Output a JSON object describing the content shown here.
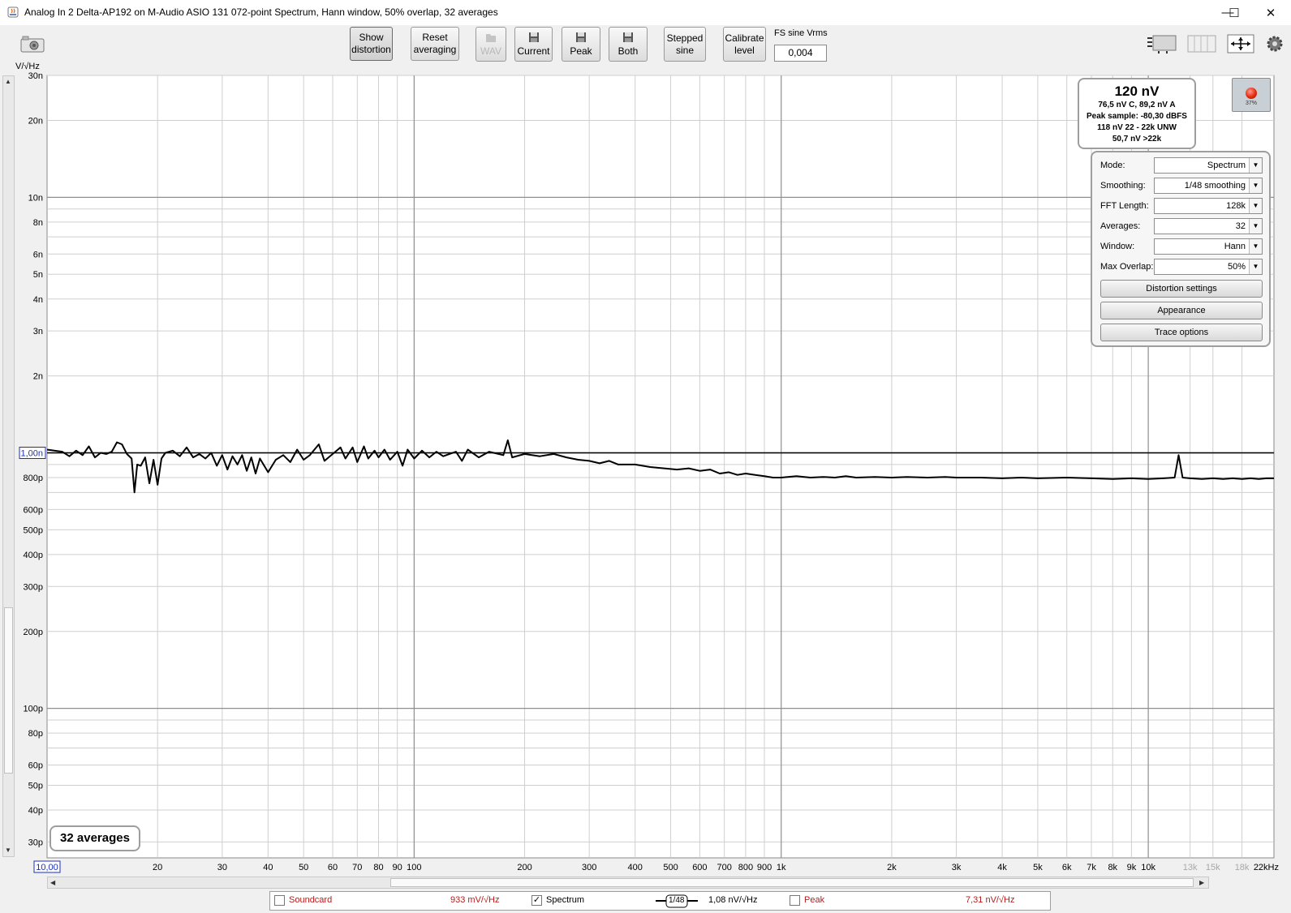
{
  "window": {
    "title": "Analog In 2 Delta-AP192 on M-Audio ASIO 131 072-point Spectrum, Hann window, 50% overlap, 32 averages",
    "controls": {
      "minimize": "—",
      "maximize": "☐",
      "close": "✕"
    }
  },
  "toolbar": {
    "show_distortion": "Show\ndistortion",
    "reset_averaging": "Reset\naveraging",
    "wav": "WAV",
    "current": "Current",
    "peak": "Peak",
    "both": "Both",
    "stepped_sine": "Stepped\nsine",
    "calibrate_level": "Calibrate\nlevel",
    "fs_sine_label": "FS sine Vrms",
    "fs_sine_value": "0,004"
  },
  "readout": {
    "main": "120 nV",
    "line1": "76,5 nV C, 89,2 nV A",
    "line2": "Peak sample: -80,30 dBFS",
    "line3": "118 nV 22 - 22k UNW",
    "line4": "50,7 nV >22k"
  },
  "record": {
    "percent": "37%"
  },
  "settings": {
    "mode_label": "Mode:",
    "mode_value": "Spectrum",
    "smoothing_label": "Smoothing:",
    "smoothing_value": "1/48 smoothing",
    "fft_label": "FFT Length:",
    "fft_value": "128k",
    "averages_label": "Averages:",
    "averages_value": "32",
    "window_label": "Window:",
    "window_value": "Hann",
    "overlap_label": "Max Overlap:",
    "overlap_value": "50%",
    "distortion_settings": "Distortion settings",
    "appearance": "Appearance",
    "trace_options": "Trace options"
  },
  "avg_badge": "32 averages",
  "legend": {
    "soundcard_label": "Soundcard",
    "soundcard_value": "933 mV/√Hz",
    "soundcard_checked": false,
    "spectrum_label": "Spectrum",
    "spectrum_value": "1,08 nV/√Hz",
    "spectrum_checked": true,
    "smoothing_tag": "1/48",
    "peak_label": "Peak",
    "peak_value": "7,31 nV/√Hz",
    "peak_checked": false,
    "check_mark": "✓"
  },
  "chart_data": {
    "type": "line",
    "ylabel": "V/√Hz",
    "xlabel": "",
    "x_scale": "log",
    "y_scale": "log",
    "xlim": [
      10,
      22000
    ],
    "ylim": [
      2.6e-11,
      3e-08
    ],
    "grid": true,
    "y_ticks": [
      {
        "v": 3e-08,
        "label": "30n",
        "major": false
      },
      {
        "v": 2e-08,
        "label": "20n",
        "major": false
      },
      {
        "v": 1e-08,
        "label": "10n",
        "major": true
      },
      {
        "v": 8e-09,
        "label": "8n",
        "major": false
      },
      {
        "v": 6e-09,
        "label": "6n",
        "major": false
      },
      {
        "v": 5e-09,
        "label": "5n",
        "major": false
      },
      {
        "v": 4e-09,
        "label": "4n",
        "major": false
      },
      {
        "v": 3e-09,
        "label": "3n",
        "major": false
      },
      {
        "v": 2e-09,
        "label": "2n",
        "major": false
      },
      {
        "v": 1e-09,
        "label": "1,00n",
        "major": true,
        "boxed": true
      },
      {
        "v": 8e-10,
        "label": "800p",
        "major": false
      },
      {
        "v": 6e-10,
        "label": "600p",
        "major": false
      },
      {
        "v": 5e-10,
        "label": "500p",
        "major": false
      },
      {
        "v": 4e-10,
        "label": "400p",
        "major": false
      },
      {
        "v": 3e-10,
        "label": "300p",
        "major": false
      },
      {
        "v": 2e-10,
        "label": "200p",
        "major": false
      },
      {
        "v": 1e-10,
        "label": "100p",
        "major": true
      },
      {
        "v": 8e-11,
        "label": "80p",
        "major": false
      },
      {
        "v": 6e-11,
        "label": "60p",
        "major": false
      },
      {
        "v": 5e-11,
        "label": "50p",
        "major": false
      },
      {
        "v": 4e-11,
        "label": "40p",
        "major": false
      },
      {
        "v": 3e-11,
        "label": "30p",
        "major": false
      }
    ],
    "y_minor_grid": [
      3e-08,
      2e-08,
      9e-09,
      8e-09,
      7e-09,
      6e-09,
      5e-09,
      4e-09,
      3e-09,
      2e-09,
      9e-10,
      8e-10,
      7e-10,
      6e-10,
      5e-10,
      4e-10,
      3e-10,
      2e-10,
      9e-11,
      8e-11,
      7e-11,
      6e-11,
      5e-11,
      4e-11,
      3e-11
    ],
    "x_ticks": [
      {
        "v": 10,
        "label": "10,00",
        "boxed": true
      },
      {
        "v": 20,
        "label": "20"
      },
      {
        "v": 30,
        "label": "30"
      },
      {
        "v": 40,
        "label": "40"
      },
      {
        "v": 50,
        "label": "50"
      },
      {
        "v": 60,
        "label": "60"
      },
      {
        "v": 70,
        "label": "70"
      },
      {
        "v": 80,
        "label": "80"
      },
      {
        "v": 90,
        "label": "90"
      },
      {
        "v": 100,
        "label": "100"
      },
      {
        "v": 200,
        "label": "200"
      },
      {
        "v": 300,
        "label": "300"
      },
      {
        "v": 400,
        "label": "400"
      },
      {
        "v": 500,
        "label": "500"
      },
      {
        "v": 600,
        "label": "600"
      },
      {
        "v": 700,
        "label": "700"
      },
      {
        "v": 800,
        "label": "800"
      },
      {
        "v": 900,
        "label": "900"
      },
      {
        "v": 1000,
        "label": "1k"
      },
      {
        "v": 2000,
        "label": "2k"
      },
      {
        "v": 3000,
        "label": "3k"
      },
      {
        "v": 4000,
        "label": "4k"
      },
      {
        "v": 5000,
        "label": "5k"
      },
      {
        "v": 6000,
        "label": "6k"
      },
      {
        "v": 7000,
        "label": "7k"
      },
      {
        "v": 8000,
        "label": "8k"
      },
      {
        "v": 9000,
        "label": "9k"
      },
      {
        "v": 10000,
        "label": "10k"
      },
      {
        "v": 13000,
        "label": "13k",
        "faded": true
      },
      {
        "v": 15000,
        "label": "15k",
        "faded": true
      },
      {
        "v": 18000,
        "label": "18k",
        "faded": true
      },
      {
        "v": 22000,
        "label": "22kHz"
      }
    ],
    "x_major_grid": [
      100,
      1000,
      10000
    ],
    "x_minor_grid": [
      20,
      30,
      40,
      50,
      60,
      70,
      80,
      90,
      200,
      300,
      400,
      500,
      600,
      700,
      800,
      900,
      2000,
      3000,
      4000,
      5000,
      6000,
      7000,
      8000,
      9000,
      13000,
      15000,
      18000
    ],
    "reference_line_y": 1e-09,
    "series": [
      {
        "name": "Spectrum",
        "color": "#000000",
        "points": [
          [
            10,
            1.03e-09
          ],
          [
            11,
            1.01e-09
          ],
          [
            11.5,
            9.7e-10
          ],
          [
            12,
            1.02e-09
          ],
          [
            12.5,
            9.8e-10
          ],
          [
            13,
            1.06e-09
          ],
          [
            13.5,
            9.6e-10
          ],
          [
            14,
            1e-09
          ],
          [
            14.5,
            9.9e-10
          ],
          [
            15,
            1.01e-09
          ],
          [
            15.5,
            1.1e-09
          ],
          [
            16,
            1.08e-09
          ],
          [
            16.5,
            9.9e-10
          ],
          [
            17,
            9.5e-10
          ],
          [
            17.3,
            7e-10
          ],
          [
            17.6,
            9e-10
          ],
          [
            18,
            8.9e-10
          ],
          [
            18.5,
            9.6e-10
          ],
          [
            19,
            7.6e-10
          ],
          [
            19.5,
            9.4e-10
          ],
          [
            20,
            7.5e-10
          ],
          [
            20.5,
            9.5e-10
          ],
          [
            21,
            1e-09
          ],
          [
            22,
            1.02e-09
          ],
          [
            23,
            9.7e-10
          ],
          [
            24,
            1.05e-09
          ],
          [
            25,
            9.6e-10
          ],
          [
            26,
            9.9e-10
          ],
          [
            27,
            9.5e-10
          ],
          [
            28,
            1e-09
          ],
          [
            29,
            8.9e-10
          ],
          [
            30,
            9.8e-10
          ],
          [
            31,
            8.6e-10
          ],
          [
            32,
            9.7e-10
          ],
          [
            33,
            9e-10
          ],
          [
            34,
            9.8e-10
          ],
          [
            35,
            8.5e-10
          ],
          [
            36,
            9.6e-10
          ],
          [
            37,
            8.3e-10
          ],
          [
            38,
            9.5e-10
          ],
          [
            40,
            8.4e-10
          ],
          [
            42,
            9.4e-10
          ],
          [
            44,
            9.8e-10
          ],
          [
            46,
            9.2e-10
          ],
          [
            48,
            1.03e-09
          ],
          [
            50,
            9.4e-10
          ],
          [
            52,
            9.8e-10
          ],
          [
            55,
            1.08e-09
          ],
          [
            57,
            9.3e-10
          ],
          [
            60,
            9.9e-10
          ],
          [
            63,
            1.05e-09
          ],
          [
            65,
            9.5e-10
          ],
          [
            68,
            1.05e-09
          ],
          [
            70,
            9.2e-10
          ],
          [
            73,
            1.06e-09
          ],
          [
            75,
            9.5e-10
          ],
          [
            78,
            1.02e-09
          ],
          [
            80,
            9.6e-10
          ],
          [
            83,
            1.03e-09
          ],
          [
            86,
            9.4e-10
          ],
          [
            90,
            1.01e-09
          ],
          [
            93,
            8.9e-10
          ],
          [
            96,
            1.03e-09
          ],
          [
            100,
            9.5e-10
          ],
          [
            105,
            1.02e-09
          ],
          [
            110,
            9.6e-10
          ],
          [
            115,
            1.01e-09
          ],
          [
            120,
            9.7e-10
          ],
          [
            130,
            1.01e-09
          ],
          [
            135,
            9.3e-10
          ],
          [
            140,
            1.03e-09
          ],
          [
            150,
            9.6e-10
          ],
          [
            160,
            1.01e-09
          ],
          [
            175,
            9.8e-10
          ],
          [
            180,
            1.12e-09
          ],
          [
            185,
            9.6e-10
          ],
          [
            200,
            9.9e-10
          ],
          [
            220,
            9.7e-10
          ],
          [
            240,
            9.9e-10
          ],
          [
            260,
            9.6e-10
          ],
          [
            280,
            9.4e-10
          ],
          [
            300,
            9.3e-10
          ],
          [
            320,
            9.1e-10
          ],
          [
            340,
            9.3e-10
          ],
          [
            360,
            9e-10
          ],
          [
            400,
            9e-10
          ],
          [
            440,
            8.8e-10
          ],
          [
            480,
            8.7e-10
          ],
          [
            520,
            8.6e-10
          ],
          [
            560,
            8.7e-10
          ],
          [
            600,
            8.5e-10
          ],
          [
            640,
            8.6e-10
          ],
          [
            680,
            8.3e-10
          ],
          [
            720,
            8.4e-10
          ],
          [
            760,
            8.2e-10
          ],
          [
            800,
            8.3e-10
          ],
          [
            850,
            8.2e-10
          ],
          [
            900,
            8.1e-10
          ],
          [
            950,
            8e-10
          ],
          [
            1000,
            8e-10
          ],
          [
            1100,
            8.1e-10
          ],
          [
            1200,
            8e-10
          ],
          [
            1300,
            8.05e-10
          ],
          [
            1400,
            8e-10
          ],
          [
            1500,
            8.1e-10
          ],
          [
            1600,
            8e-10
          ],
          [
            1800,
            8.05e-10
          ],
          [
            2000,
            8e-10
          ],
          [
            2200,
            8.05e-10
          ],
          [
            2500,
            8e-10
          ],
          [
            2800,
            8.05e-10
          ],
          [
            3000,
            8e-10
          ],
          [
            3500,
            8e-10
          ],
          [
            4000,
            7.95e-10
          ],
          [
            4500,
            8e-10
          ],
          [
            5000,
            7.95e-10
          ],
          [
            6000,
            8e-10
          ],
          [
            7000,
            7.95e-10
          ],
          [
            8000,
            7.9e-10
          ],
          [
            9000,
            7.95e-10
          ],
          [
            10000,
            7.9e-10
          ],
          [
            11000,
            7.95e-10
          ],
          [
            11800,
            8e-10
          ],
          [
            12100,
            9.8e-10
          ],
          [
            12400,
            8e-10
          ],
          [
            13000,
            7.95e-10
          ],
          [
            14000,
            7.9e-10
          ],
          [
            15000,
            7.95e-10
          ],
          [
            16000,
            7.9e-10
          ],
          [
            17000,
            7.95e-10
          ],
          [
            18000,
            7.9e-10
          ],
          [
            19000,
            7.95e-10
          ],
          [
            20000,
            7.9e-10
          ],
          [
            21000,
            7.95e-10
          ],
          [
            22000,
            7.95e-10
          ]
        ]
      }
    ]
  },
  "colors": {
    "plot_bg": "#ffffff",
    "grid_major": "#8f8f8f",
    "grid_minor": "#cfcfcf",
    "trace": "#000000",
    "accent_blue": "#1a2fbf",
    "legend_red": "#b81c1c"
  }
}
